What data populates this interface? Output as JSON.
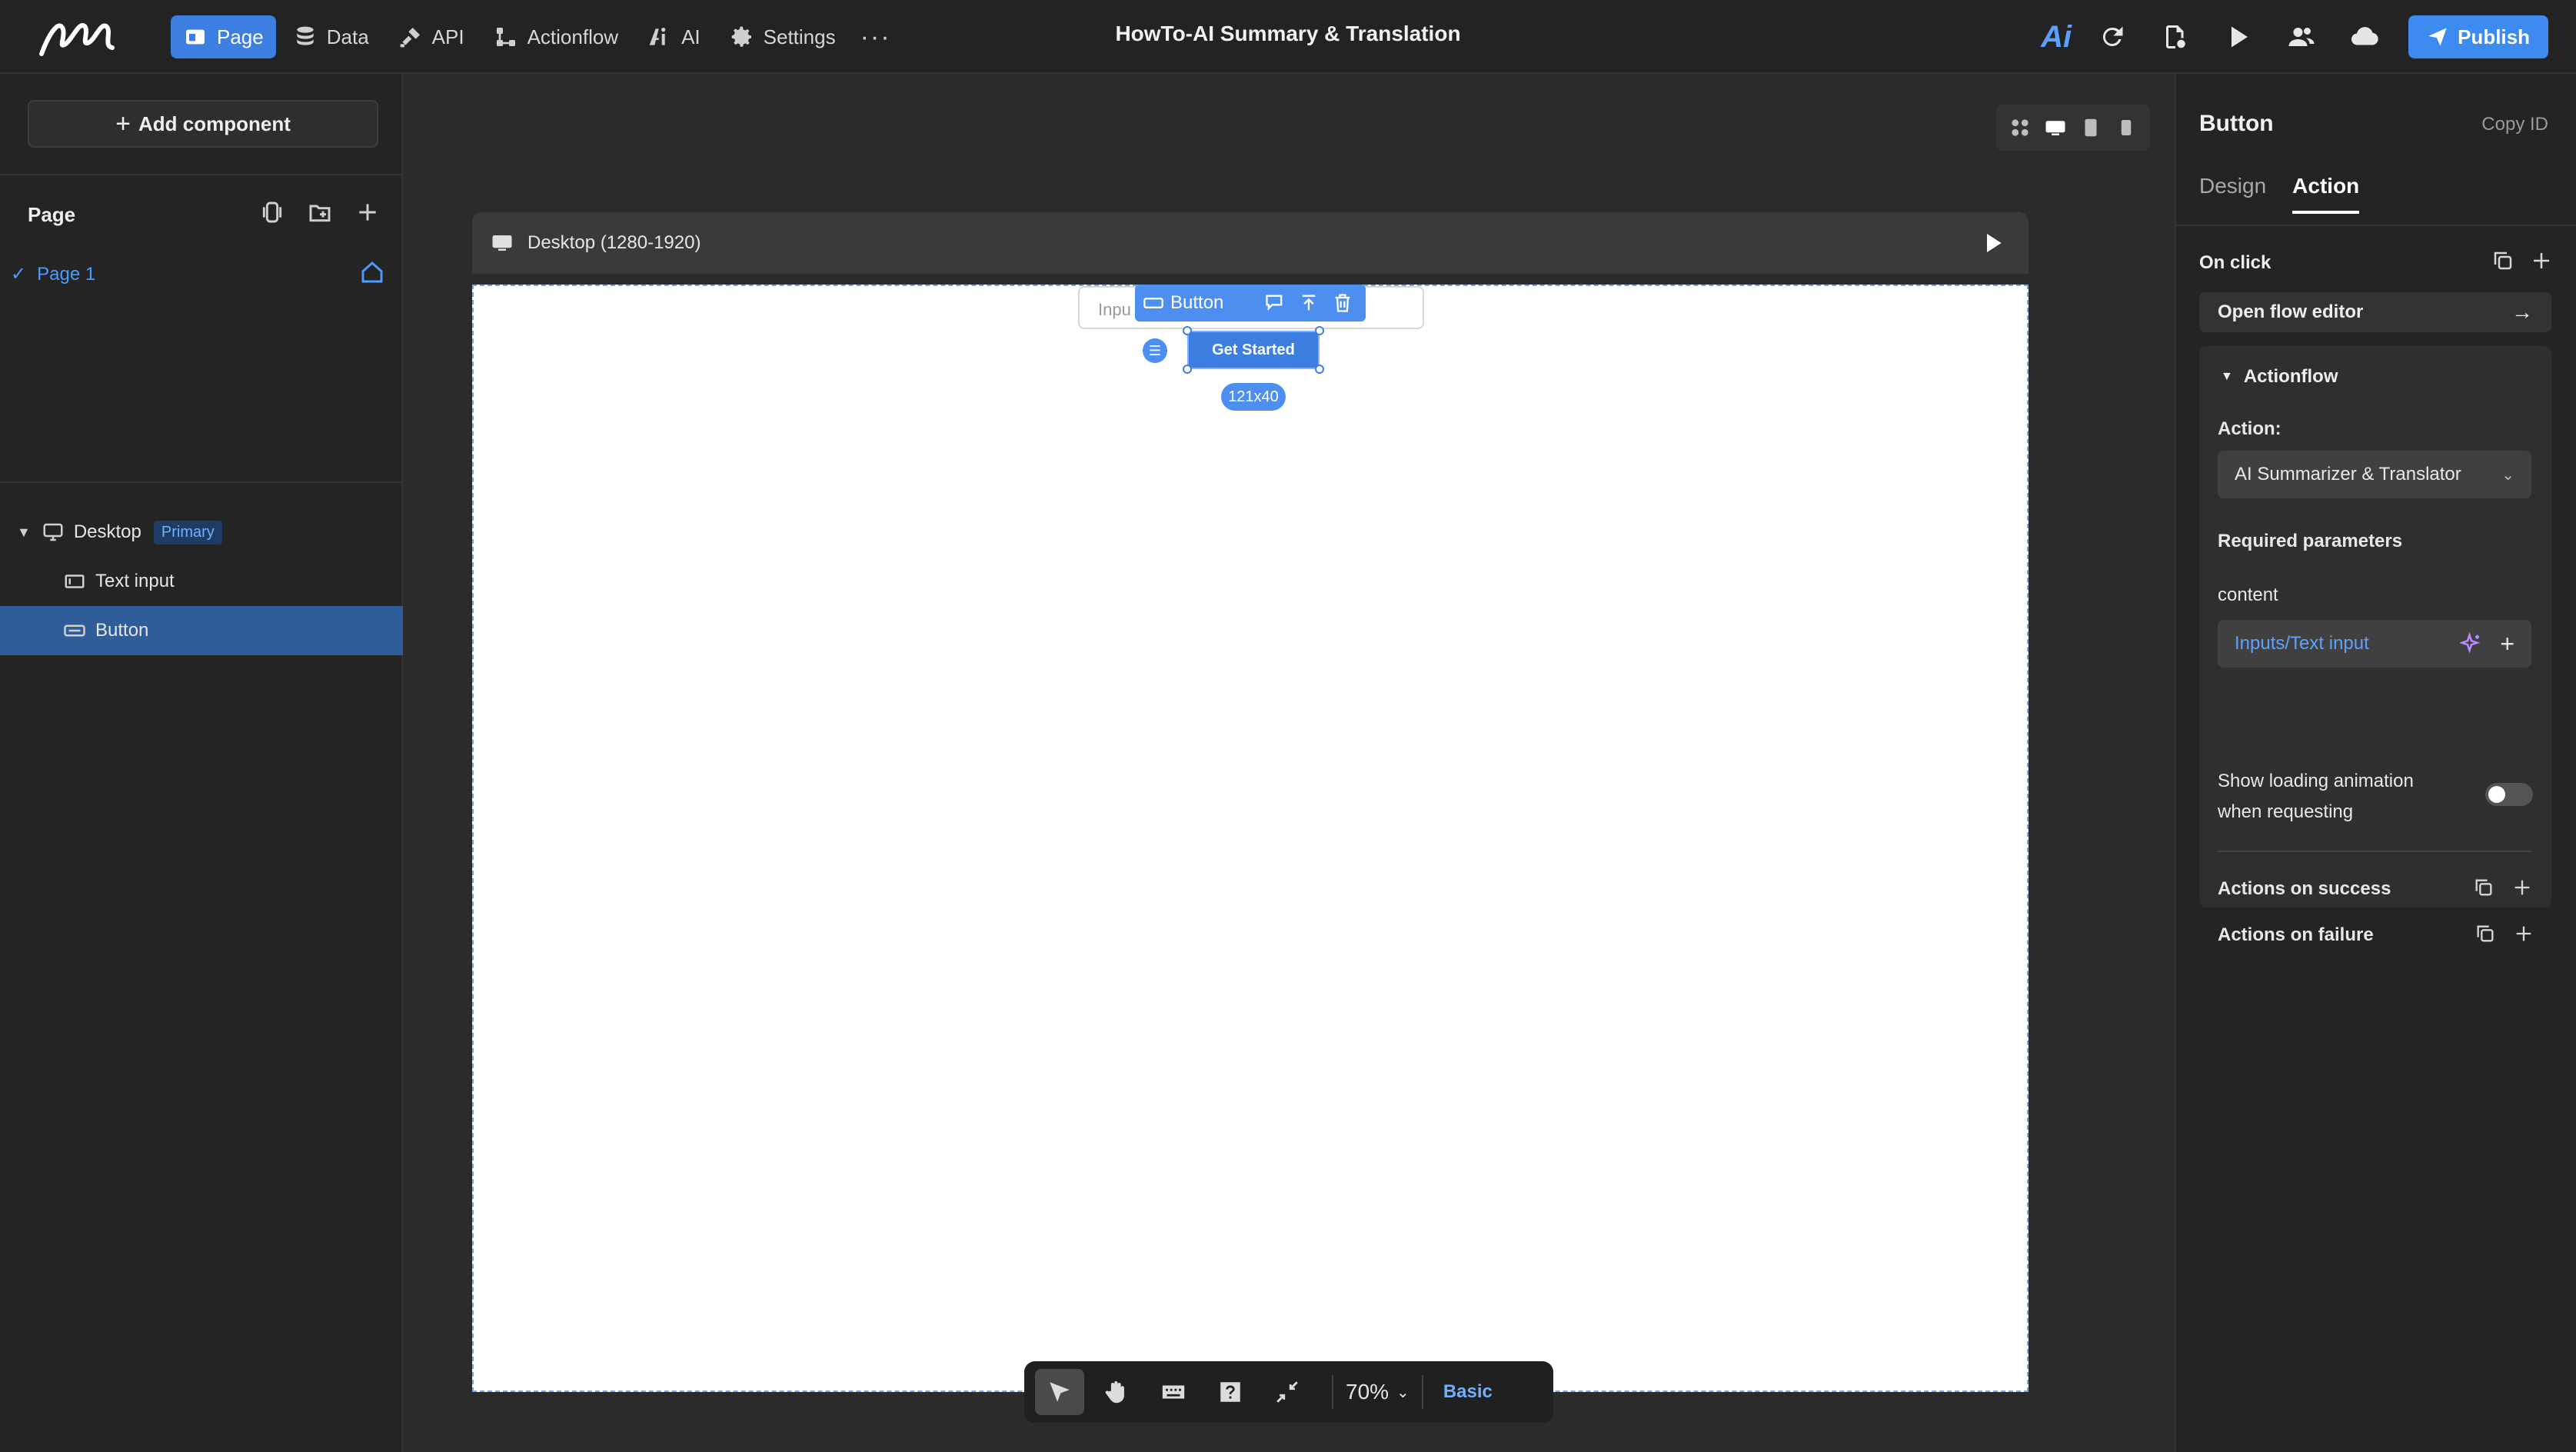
{
  "topbar": {
    "nav": [
      {
        "label": "Page",
        "icon": "page-icon",
        "active": true
      },
      {
        "label": "Data",
        "icon": "database-icon",
        "active": false
      },
      {
        "label": "API",
        "icon": "api-plug-icon",
        "active": false
      },
      {
        "label": "Actionflow",
        "icon": "flow-icon",
        "active": false
      },
      {
        "label": "AI",
        "icon": "ai-icon",
        "active": false
      },
      {
        "label": "Settings",
        "icon": "gear-icon",
        "active": false
      }
    ],
    "more": "···",
    "title": "HowTo-AI Summary & Translation",
    "ai_mark": "Ai",
    "publish_label": "Publish"
  },
  "left": {
    "add_component": "Add component",
    "page_section": "Page",
    "page_item": "Page 1",
    "tree": [
      {
        "label": "Desktop",
        "badge": "Primary",
        "icon": "monitor-icon",
        "selected": false
      },
      {
        "label": "Text input",
        "icon": "text-input-icon",
        "selected": false
      },
      {
        "label": "Button",
        "icon": "button-icon",
        "selected": true
      }
    ]
  },
  "canvas": {
    "frame_label": "Desktop (1280-1920)",
    "input_placeholder": "Inpu",
    "selection_label": "Button",
    "button_text": "Get Started",
    "size_label": "121x40",
    "zoom": "70%",
    "mode": "Basic"
  },
  "right": {
    "title": "Button",
    "copy_id": "Copy ID",
    "tabs": [
      {
        "label": "Design",
        "active": false
      },
      {
        "label": "Action",
        "active": true
      }
    ],
    "on_click": "On click",
    "open_flow_editor": "Open flow editor",
    "actionflow": "Actionflow",
    "action_label": "Action:",
    "action_value": "AI Summarizer & Translator",
    "required_params": "Required parameters",
    "param_name": "content",
    "param_value": "Inputs/Text input",
    "loading_label_1": "Show loading animation",
    "loading_label_2": "when requesting",
    "loading_enabled": false,
    "actions_success": "Actions on success",
    "actions_failure": "Actions on failure"
  },
  "colors": {
    "accent": "#3d7fe0",
    "publish": "#3d8bf0",
    "link": "#5da2ff",
    "selected_row": "#2e5d99"
  }
}
